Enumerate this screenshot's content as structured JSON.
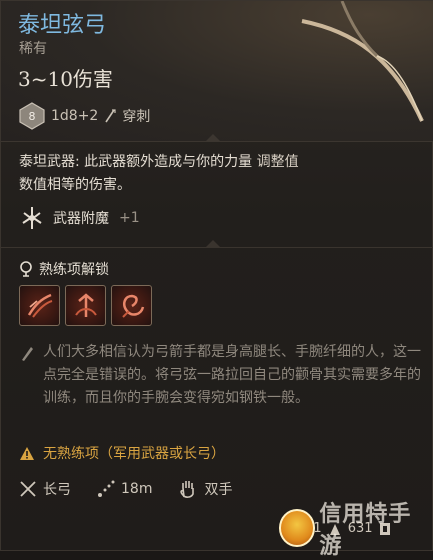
{
  "item": {
    "name": "泰坦弦弓",
    "rarity": "稀有",
    "damage": "3~10伤害",
    "dice_value": "8",
    "damage_formula": "1d8+2",
    "damage_type": "穿刺"
  },
  "description": {
    "line1_prefix": "泰坦武器: 此武器额外造成与你的力量",
    "line1_highlight": "调整值",
    "line2": "数值相等的伤害。"
  },
  "enchant": {
    "label": "武器附魔",
    "value": "+1"
  },
  "proficiency": {
    "heading": "熟练项解锁",
    "actions": [
      "attack-icon-1",
      "attack-icon-2",
      "attack-icon-3"
    ]
  },
  "lore": "人们大多相信认为弓箭手都是身高腿长、手腕纤细的人，这一点完全是错误的。将弓弦一路拉回自己的颧骨其实需要多年的训练，而且你的手腕会变得宛如钢铁一般。",
  "warning": "无熟练项（军用武器或长弓）",
  "properties": {
    "weapon_type": "长弓",
    "range": "18m",
    "handedness": "双手"
  },
  "footer": {
    "weight": "1.1",
    "value": "631"
  },
  "watermark_text": "信用特手游",
  "colors": {
    "title": "#7fb9e0",
    "warning": "#d9a441",
    "lore": "#8f887e"
  }
}
